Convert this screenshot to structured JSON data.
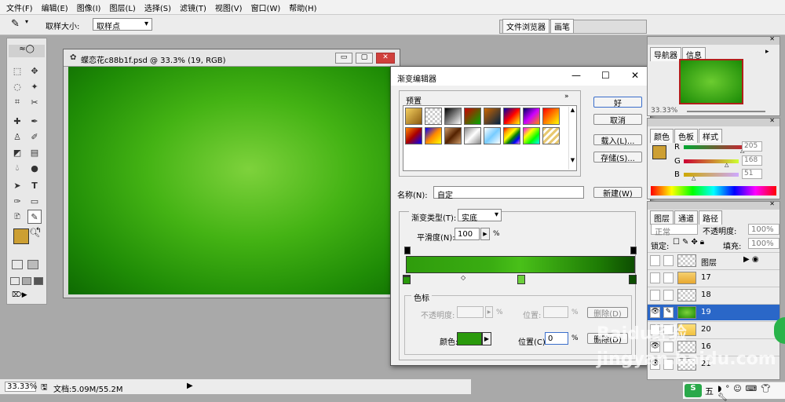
{
  "menu": [
    "文件(F)",
    "编辑(E)",
    "图像(I)",
    "图层(L)",
    "选择(S)",
    "滤镜(T)",
    "视图(V)",
    "窗口(W)",
    "帮助(H)"
  ],
  "options": {
    "sample_label": "取样大小:",
    "sample_value": "取样点"
  },
  "tabs_right": [
    "文件浏览器",
    "画笔"
  ],
  "doc": {
    "title": "蝶恋花c88b1f.psd @ 33.3% (19, RGB)"
  },
  "status": {
    "zoom": "33.33%",
    "doc": "文档:5.09M/55.2M"
  },
  "gradient": {
    "title": "渐变编辑器",
    "presets_label": "预置",
    "name_label": "名称(N):",
    "name_value": "自定",
    "type_label": "渐变类型(T):",
    "type_value": "实底",
    "smooth_label": "平滑度(N):",
    "smooth_value": "100",
    "pct": "%",
    "stops_label": "色标",
    "opacity_label": "不透明度:",
    "pos_label": "位置:",
    "delete_label": "删除(D)",
    "color_label": "颜色:",
    "pos2_label": "位置(C):",
    "pos2_value": "0",
    "btn_ok": "好",
    "btn_cancel": "取消",
    "btn_load": "载入(L)...",
    "btn_save": "存储(S)...",
    "btn_new": "新建(W)"
  },
  "navigator": {
    "tabs": [
      "导航器",
      "信息"
    ],
    "zoom": "33.33%"
  },
  "color_panel": {
    "tabs": [
      "颜色",
      "色板",
      "样式"
    ],
    "channels": [
      {
        "name": "R",
        "value": "205"
      },
      {
        "name": "G",
        "value": "168"
      },
      {
        "name": "B",
        "value": "51"
      }
    ]
  },
  "layers": {
    "tabs": [
      "图层",
      "通道",
      "路径"
    ],
    "mode": "正常",
    "opacity_label": "不透明度:",
    "opacity": "100%",
    "lock_label": "锁定:",
    "fill_label": "填充:",
    "fill": "100%",
    "items": [
      {
        "name": "图层"
      },
      {
        "name": "17"
      },
      {
        "name": "18"
      },
      {
        "name": "19"
      },
      {
        "name": "20"
      },
      {
        "name": "16"
      },
      {
        "name": "21"
      }
    ]
  },
  "watermark": "Baidu经验 jingyan.baidu.com",
  "taskbar": "五"
}
